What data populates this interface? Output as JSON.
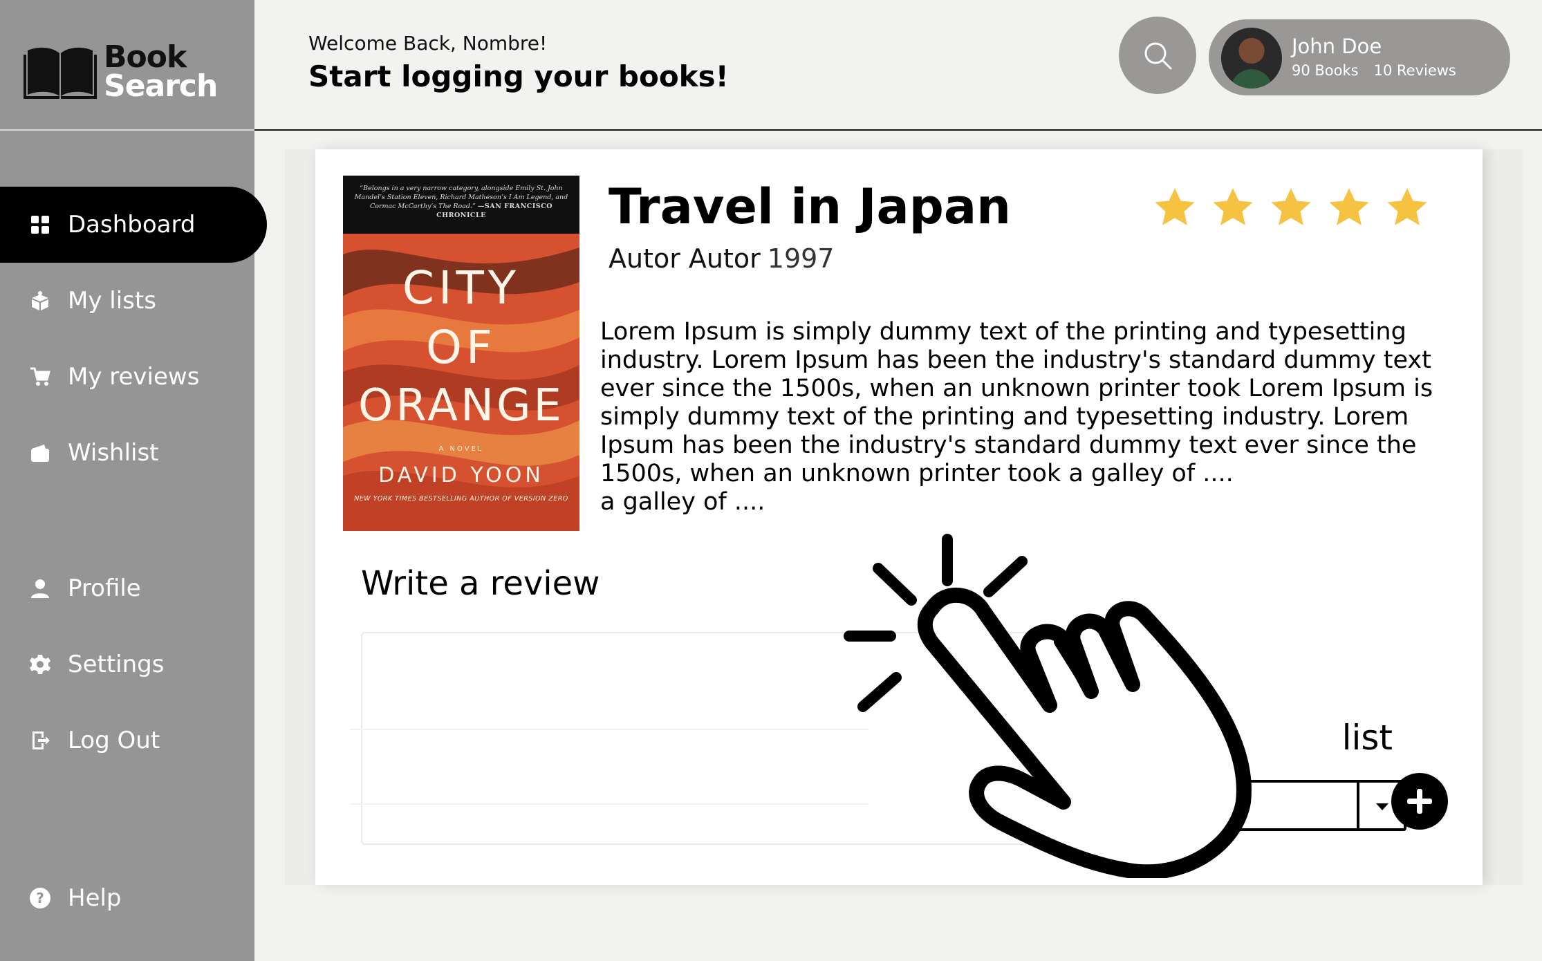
{
  "brand": {
    "line1": "Book",
    "line2": "Search"
  },
  "header": {
    "welcome": "Welcome Back, Nombre!",
    "headline": "Start logging your books!"
  },
  "user": {
    "name": "John Doe",
    "books": "90 Books",
    "reviews": "10 Reviews"
  },
  "sidebar": {
    "items": [
      {
        "label": "Dashboard",
        "icon": "grid-icon",
        "active": true
      },
      {
        "label": "My lists",
        "icon": "box-icon",
        "active": false
      },
      {
        "label": "My reviews",
        "icon": "cart-icon",
        "active": false
      },
      {
        "label": "Wishlist",
        "icon": "wallet-icon",
        "active": false
      },
      {
        "label": "Profile",
        "icon": "person-icon",
        "active": false
      },
      {
        "label": "Settings",
        "icon": "gear-icon",
        "active": false
      },
      {
        "label": "Log Out",
        "icon": "logout-icon",
        "active": false
      },
      {
        "label": "Help",
        "icon": "help-icon",
        "active": false
      }
    ]
  },
  "book": {
    "title": "Travel in Japan",
    "author": "Autor Autor",
    "year": "1997",
    "rating": 5,
    "rating_max": 5,
    "star_color": "#F5C242",
    "description": "Lorem Ipsum is simply dummy text of the printing and typesetting industry. Lorem Ipsum has been the industry's standard dummy text ever since the 1500s, when an unknown printer took Lorem Ipsum is simply dummy text of the printing and typesetting industry. Lorem Ipsum has been the industry's standard dummy text ever since the 1500s, when an unknown printer took a galley of ....",
    "description_tail": "a galley of ....",
    "cover": {
      "quote": "“Belongs in a very narrow category, alongside Emily St. John Mandel’s Station Eleven, Richard Matheson’s I Am Legend, and Cormac McCarthy’s The Road.”",
      "quote_source": "—SAN FRANCISCO CHRONICLE",
      "title_line1": "CITY",
      "title_line2": "OF",
      "title_line3": "ORANGE",
      "subtitle": "A NOVEL",
      "author": "DAVID YOON",
      "blurb": "NEW YORK TIMES BESTSELLING AUTHOR OF VERSION ZERO"
    }
  },
  "review": {
    "heading": "Write a review",
    "value": ""
  },
  "add_to_list": {
    "label": "list",
    "selected": ""
  }
}
